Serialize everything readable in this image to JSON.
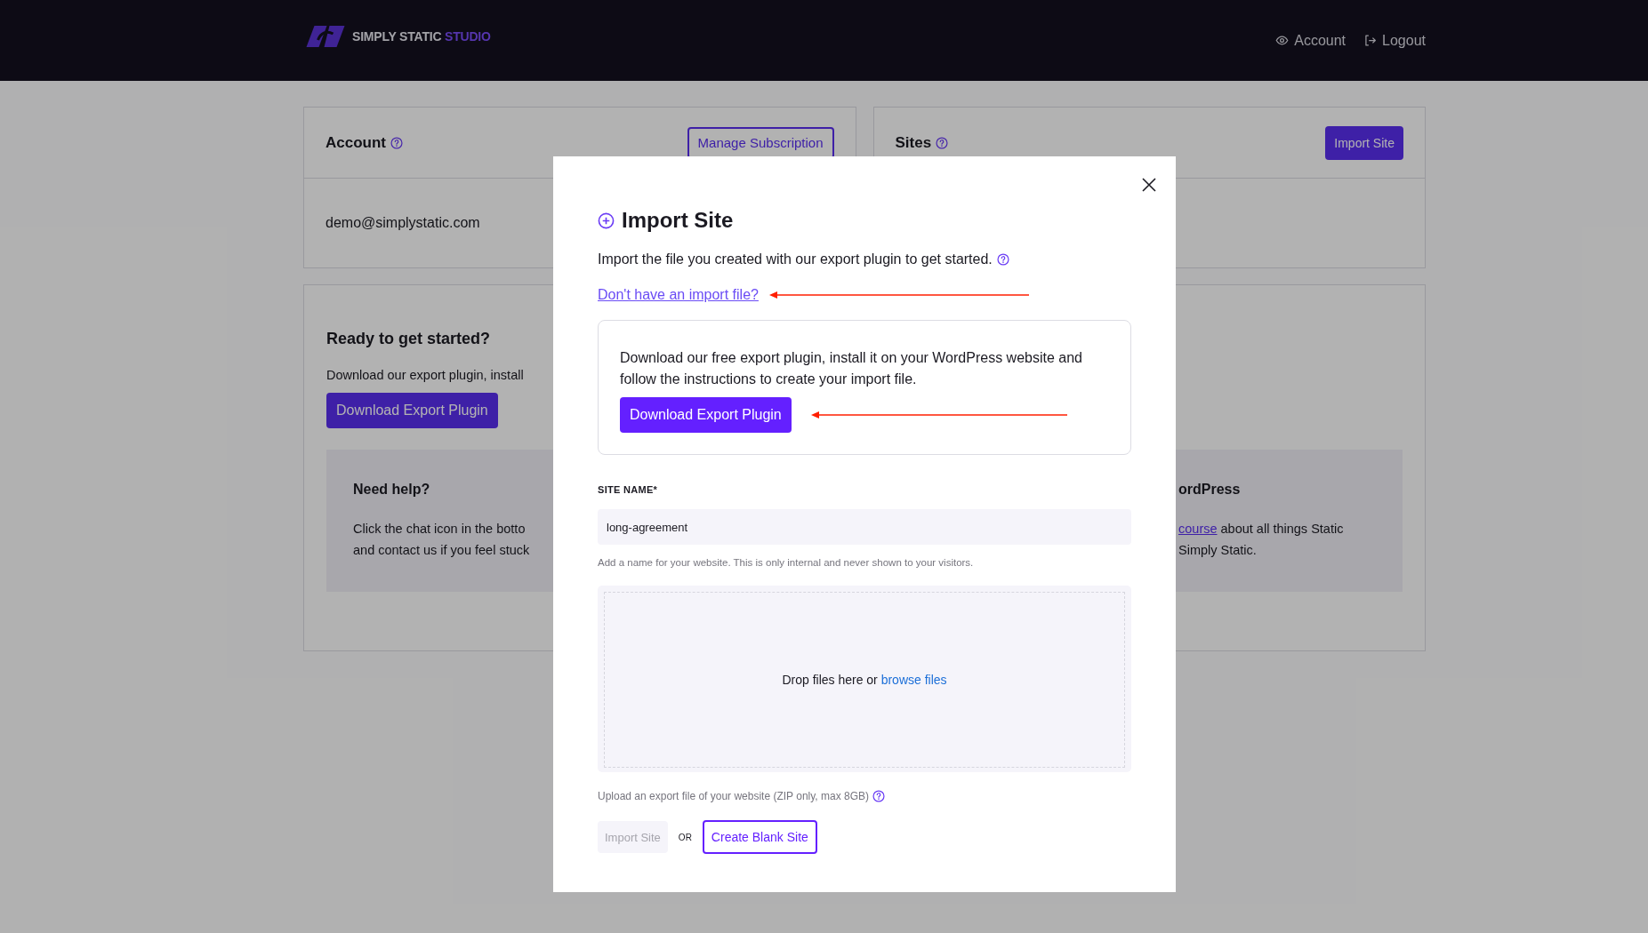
{
  "header": {
    "logo": {
      "text": "SIMPLY STATIC",
      "accent": "STUDIO"
    },
    "nav": [
      {
        "label": "Account",
        "kind": "eye"
      },
      {
        "label": "Logout",
        "kind": "logout"
      }
    ]
  },
  "account_card": {
    "title": "Account",
    "button": "Manage Subscription",
    "email": "demo@simplystatic.com"
  },
  "sites_card": {
    "title": "Sites",
    "button": "Import Site"
  },
  "getting_started": {
    "title": "Ready to get started?",
    "text": "Download our export plugin, install",
    "button": "Download Export Plugin",
    "help_left": {
      "title": "Need help?",
      "lines": [
        "Click the chat icon in the botto",
        "and contact us if you feel stuck"
      ]
    },
    "help_right": {
      "title": "ordPress",
      "link": "course",
      "link_tail": " about all things Static",
      "last_line": "Simply Static."
    }
  },
  "modal": {
    "title": "Import Site",
    "intro": "Import the file you created with our export plugin to get started.",
    "help_link": "Don't have an import file?",
    "info_box": {
      "text": "Download our free export plugin, install it on your WordPress website and follow the instructions to create your import file.",
      "button": "Download Export Plugin"
    },
    "site_name": {
      "label": "SITE NAME*",
      "value": "long-agreement",
      "hint": "Add a name for your website. This is only internal and never shown to your visitors."
    },
    "dropzone": {
      "text": "Drop files here or",
      "link": "browse files"
    },
    "upload_hint": "Upload an export file of your website (ZIP only, max 8GB)",
    "actions": {
      "import": {
        "label": "Import Site",
        "disabled": true
      },
      "separator": "OR",
      "create": {
        "label": "Create Blank Site"
      }
    }
  }
}
